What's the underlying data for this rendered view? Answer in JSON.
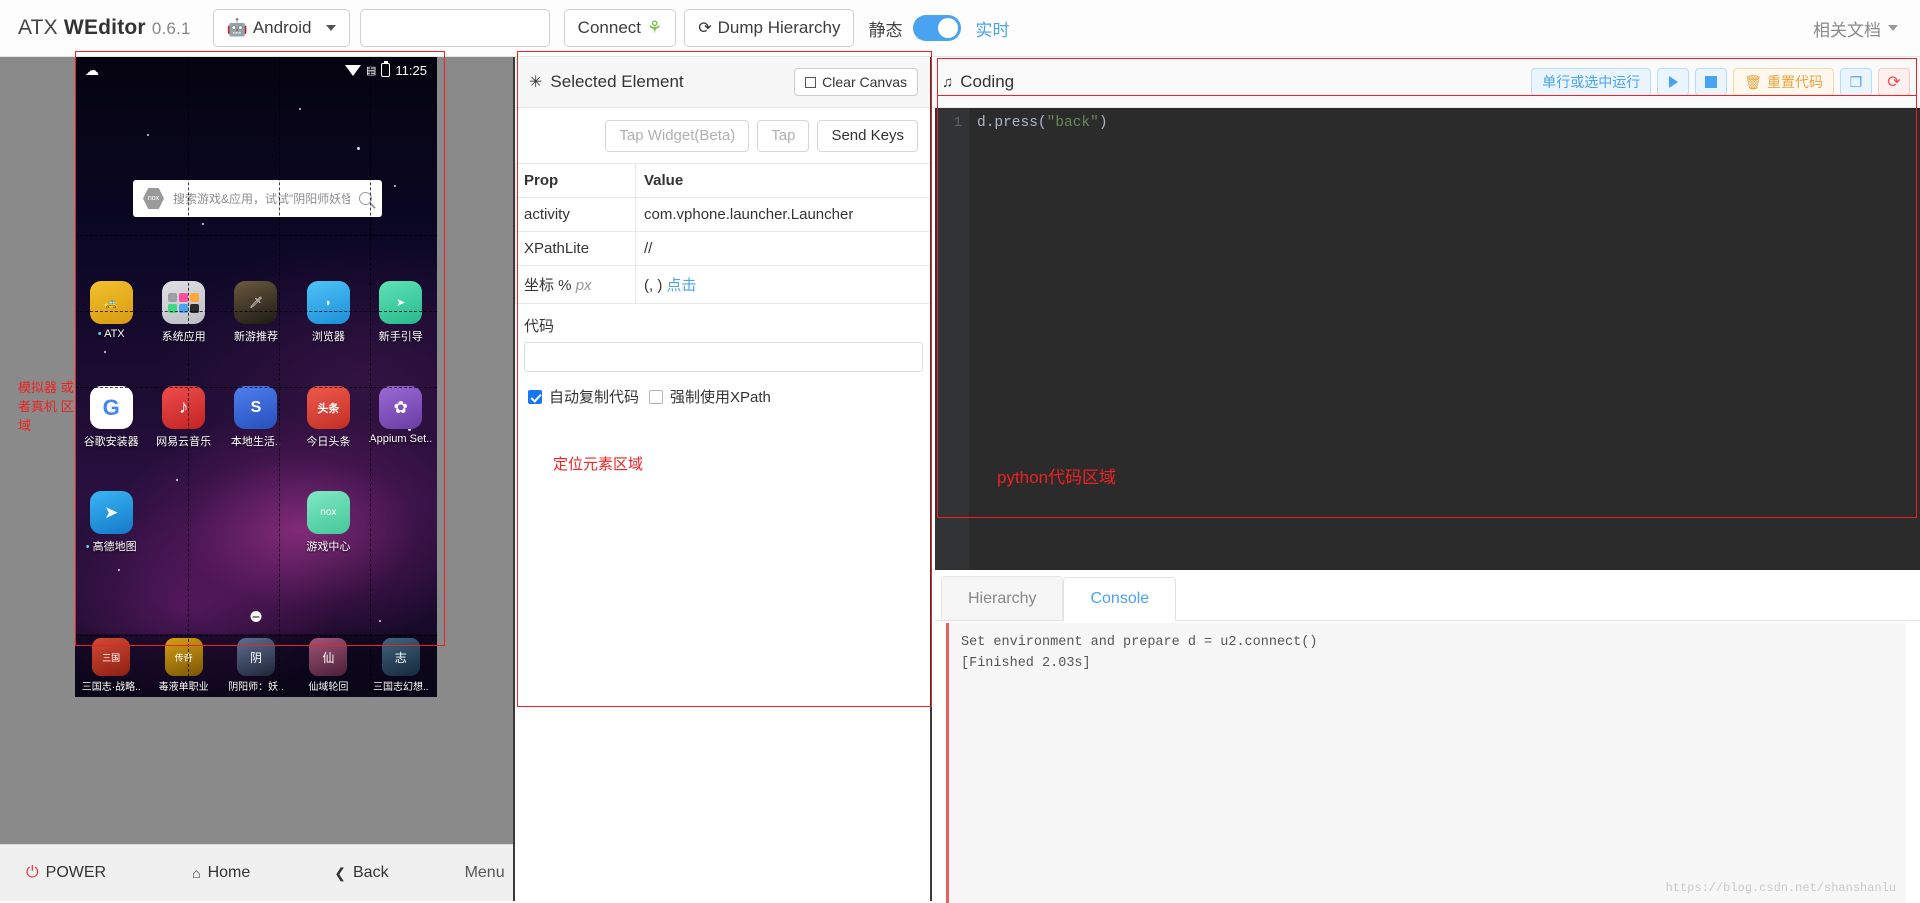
{
  "header": {
    "brand_prefix": "ATX ",
    "brand_bold": "WEditor",
    "version": "0.6.1",
    "platform_label": "Android",
    "platform_icon": "android-icon",
    "device_value": "",
    "device_placeholder": "",
    "connect_label": "Connect",
    "connect_icon": "leaf-icon",
    "dump_label": "Dump Hierarchy",
    "dump_icon": "refresh-icon",
    "toggle_left_label": "静态",
    "toggle_right_label": "实时",
    "toggle_on": true,
    "docs_label": "相关文档"
  },
  "device": {
    "annotation": "模拟器 或者真机 区域",
    "statusbar": {
      "time": "11:25",
      "wifi_icon": "wifi-icon",
      "battery_icon": "battery-icon",
      "cloud_icon": "cloud-icon"
    },
    "search": {
      "placeholder": "搜索游戏&应用，试试\"阴阳师妖怪屋\"",
      "logo_text": "nox",
      "search_icon": "magnifier-icon"
    },
    "apps_row1": [
      {
        "name": "ATX",
        "dot": true,
        "color1": "#f2c12e",
        "color2": "#d79b10",
        "glyph": "🚕"
      },
      {
        "name": "系统应用",
        "dot": false,
        "color1": "#d9dade",
        "color2": "#bcbec4",
        "glyph": "▦"
      },
      {
        "name": "新游推荐",
        "dot": false,
        "color1": "#3b3326",
        "color2": "#1d1913",
        "glyph": "🗡"
      },
      {
        "name": "浏览器",
        "dot": false,
        "color1": "#38b6f0",
        "color2": "#1b8fd8",
        "glyph": "◗"
      },
      {
        "name": "新手引导",
        "dot": false,
        "color1": "#4ad6a8",
        "color2": "#27b98c",
        "glyph": "➤"
      }
    ],
    "apps_row2": [
      {
        "name": "谷歌安装器",
        "dot": false,
        "color1": "#ffffff",
        "color2": "#ededed",
        "glyph": "G"
      },
      {
        "name": "网易云音乐",
        "dot": false,
        "color1": "#e03b3b",
        "color2": "#c22323",
        "glyph": "♪"
      },
      {
        "name": "本地生活..",
        "dot": false,
        "color1": "#3d6fe0",
        "color2": "#2650bb",
        "glyph": "S"
      },
      {
        "name": "今日头条",
        "dot": false,
        "color1": "#e8453c",
        "color2": "#c32f27",
        "glyph": "头条"
      },
      {
        "name": "Appium Set..",
        "dot": false,
        "color1": "#8b5cc7",
        "color2": "#6a3da3",
        "glyph": "✿"
      }
    ],
    "apps_row3": [
      {
        "name": "高德地图",
        "dot": true,
        "color1": "#2aa3f0",
        "color2": "#1478c8",
        "glyph": "➤"
      },
      {
        "name": "",
        "dot": false,
        "color1": "transparent",
        "color2": "transparent",
        "glyph": ""
      },
      {
        "name": "",
        "dot": false,
        "color1": "transparent",
        "color2": "transparent",
        "glyph": ""
      },
      {
        "name": "游戏中心",
        "dot": false,
        "color1": "#6fdcb6",
        "color2": "#45c79a",
        "glyph": "nox"
      },
      {
        "name": "",
        "dot": false,
        "color1": "transparent",
        "color2": "transparent",
        "glyph": ""
      }
    ],
    "dock": [
      {
        "name": "三国志·战略..",
        "color1": "#c0392b",
        "color2": "#8e1f13",
        "glyph": "三国"
      },
      {
        "name": "毒液单职业",
        "color1": "#b8860b",
        "color2": "#7a5605",
        "glyph": "传奇"
      },
      {
        "name": "阴阳师：妖..",
        "color1": "#44506b",
        "color2": "#1f2738",
        "glyph": "阴"
      },
      {
        "name": "仙域轮回",
        "color1": "#7b3f5e",
        "color2": "#4a2038",
        "glyph": "仙"
      },
      {
        "name": "三国志幻想..",
        "color1": "#2f4a63",
        "color2": "#16293b",
        "glyph": "志"
      }
    ],
    "navbar": [
      {
        "label": "POWER",
        "icon": "power-icon"
      },
      {
        "label": "Home",
        "icon": "home-icon"
      },
      {
        "label": "Back",
        "icon": "back-chevron-icon"
      },
      {
        "label": "Menu",
        "icon": "menu-icon"
      }
    ]
  },
  "selected_element": {
    "title": "Selected Element",
    "title_icon": "target-icon",
    "clear_canvas_label": "Clear Canvas",
    "actions": [
      {
        "label": "Tap Widget(Beta)",
        "disabled": true
      },
      {
        "label": "Tap",
        "disabled": true
      },
      {
        "label": "Send Keys",
        "disabled": false
      }
    ],
    "table": {
      "headers": [
        "Prop",
        "Value"
      ],
      "rows": [
        {
          "prop": "activity",
          "value": "com.vphone.launcher.Launcher"
        },
        {
          "prop": "XPathLite",
          "value": "//"
        },
        {
          "prop": "坐标 % px",
          "value": "(, )",
          "link": "点击"
        }
      ]
    },
    "code_label": "代码",
    "code_value": "",
    "checkbox_auto_copy": {
      "label": "自动复制代码",
      "checked": true
    },
    "checkbox_force_xpath": {
      "label": "强制使用XPath",
      "checked": false
    },
    "annotation": "定位元素区域"
  },
  "coding": {
    "title": "Coding",
    "title_icon": "music-note-icon",
    "tools": [
      {
        "label": "单行或选中运行",
        "name": "run-selection-button"
      },
      {
        "label": "",
        "name": "run-button",
        "icon": "play-icon"
      },
      {
        "label": "",
        "name": "stop-button",
        "icon": "stop-icon"
      },
      {
        "label": "重置代码",
        "name": "reset-code-button",
        "icon": "trash-icon"
      },
      {
        "label": "",
        "name": "copy-button",
        "icon": "copy-icon"
      },
      {
        "label": "",
        "name": "reload-button",
        "icon": "reload-icon"
      }
    ],
    "editor": {
      "line_number": "1",
      "code_prefix": "d.press",
      "code_paren_open": "(",
      "code_string": "\"back\"",
      "code_paren_close": ")"
    },
    "annotation": "python代码区域",
    "tabs": [
      {
        "label": "Hierarchy",
        "active": false
      },
      {
        "label": "Console",
        "active": true
      }
    ],
    "console_lines": [
      "Set environment and prepare d = u2.connect()",
      "[Finished 2.03s]"
    ]
  },
  "watermark": "https://blog.csdn.net/shanshanlu"
}
